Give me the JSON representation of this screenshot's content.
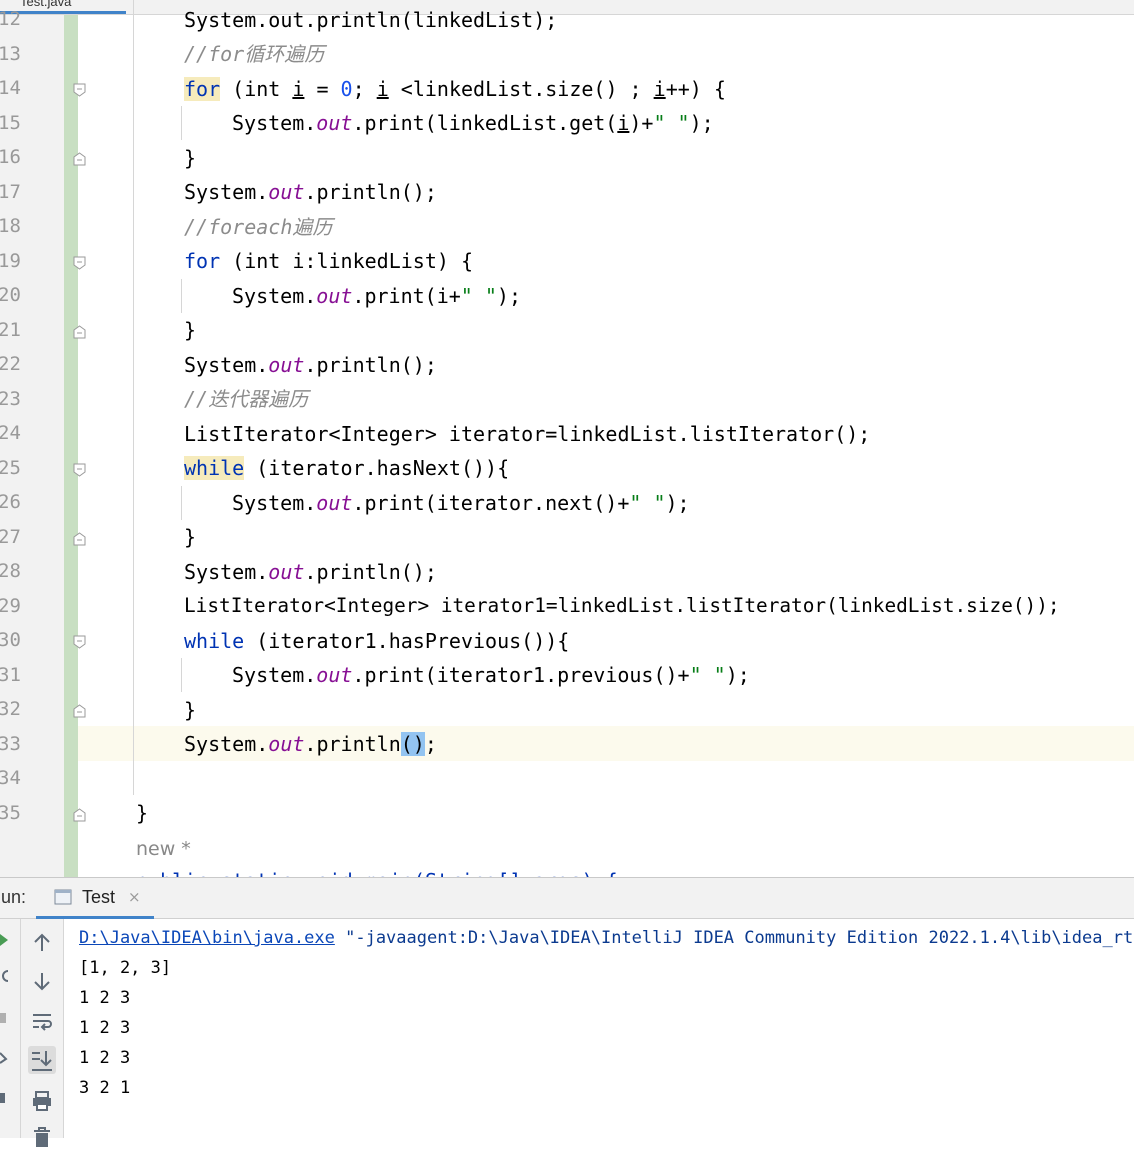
{
  "editor": {
    "tab_label": "Test.java",
    "line_numbers": [
      "12",
      "13",
      "14",
      "15",
      "16",
      "17",
      "18",
      "19",
      "20",
      "21",
      "22",
      "23",
      "24",
      "25",
      "26",
      "27",
      "28",
      "29",
      "30",
      "31",
      "32",
      "33",
      "34",
      "35"
    ],
    "code": {
      "l12": "System.out.println(linkedList);",
      "l13_comment": "//for循环遍历",
      "l14_kw": "for",
      "l14_a": " (int ",
      "l14_i1": "i",
      "l14_b": " = ",
      "l14_num": "0",
      "l14_c": "; ",
      "l14_i2": "i",
      "l14_d": " <linkedList.size() ; ",
      "l14_i3": "i",
      "l14_e": "++) {",
      "l15_a": "System.",
      "l15_fld": "out",
      "l15_b": ".print(linkedList.get(",
      "l15_i": "i",
      "l15_c": ")+",
      "l15_str": "\" \"",
      "l15_d": ");",
      "l16": "}",
      "l17_a": "System.",
      "l17_fld": "out",
      "l17_b": ".println();",
      "l18_comment": "//foreach遍历",
      "l19_kw": "for",
      "l19_a": " (int i:linkedList) {",
      "l20_a": "System.",
      "l20_fld": "out",
      "l20_b": ".print(i+",
      "l20_str": "\" \"",
      "l20_c": ");",
      "l21": "}",
      "l22_a": "System.",
      "l22_fld": "out",
      "l22_b": ".println();",
      "l23_comment": "//迭代器遍历",
      "l24": "ListIterator<Integer> iterator=linkedList.listIterator();",
      "l25_kw": "while",
      "l25_a": " (iterator.hasNext()){",
      "l26_a": "System.",
      "l26_fld": "out",
      "l26_b": ".print(iterator.next()+",
      "l26_str": "\" \"",
      "l26_c": ");",
      "l27": "}",
      "l28_a": "System.",
      "l28_fld": "out",
      "l28_b": ".println();",
      "l29": "ListIterator<Integer> iterator1=linkedList.listIterator(linkedList.size());",
      "l30_kw": "while",
      "l30_a": " (iterator1.hasPrevious()){",
      "l31_a": "System.",
      "l31_fld": "out",
      "l31_b": ".print(iterator1.previous()+",
      "l31_str": "\" \"",
      "l31_c": ");",
      "l32": "}",
      "l33_a": "System.",
      "l33_fld": "out",
      "l33_b": ".println",
      "l33_paren": "()",
      "l33_c": ";",
      "l35": "}",
      "inlay": "new *",
      "l37_partial": "public static void main(String[] args) {"
    }
  },
  "run_panel": {
    "label": "Run:",
    "tab_name": "Test",
    "tab_close": "×",
    "console": {
      "cmd_link": "D:\\Java\\IDEA\\bin\\java.exe",
      "cmd_rest": " \"-javaagent:D:\\Java\\IDEA\\IntelliJ IDEA Community Edition 2022.1.4\\lib\\idea_rt.jar",
      "out1": "[1, 2, 3]",
      "out2": "1 2 3",
      "out3": "1 2 3",
      "out4": "1 2 3",
      "out5": "3 2 1"
    }
  },
  "colors": {
    "keyword": "#0033b3",
    "field": "#871094",
    "number": "#1750eb",
    "comment": "#8c8c8c",
    "string": "#067d17",
    "caret_row": "#fcfaed",
    "vcs_added": "#c8dfc2",
    "accent": "#4083c9"
  },
  "icons": {
    "toolbar": [
      "rerun-icon",
      "stop-icon",
      "up-arrow-icon",
      "down-arrow-icon",
      "soft-wrap-icon",
      "scroll-to-end-icon",
      "print-icon",
      "trash-icon"
    ]
  }
}
